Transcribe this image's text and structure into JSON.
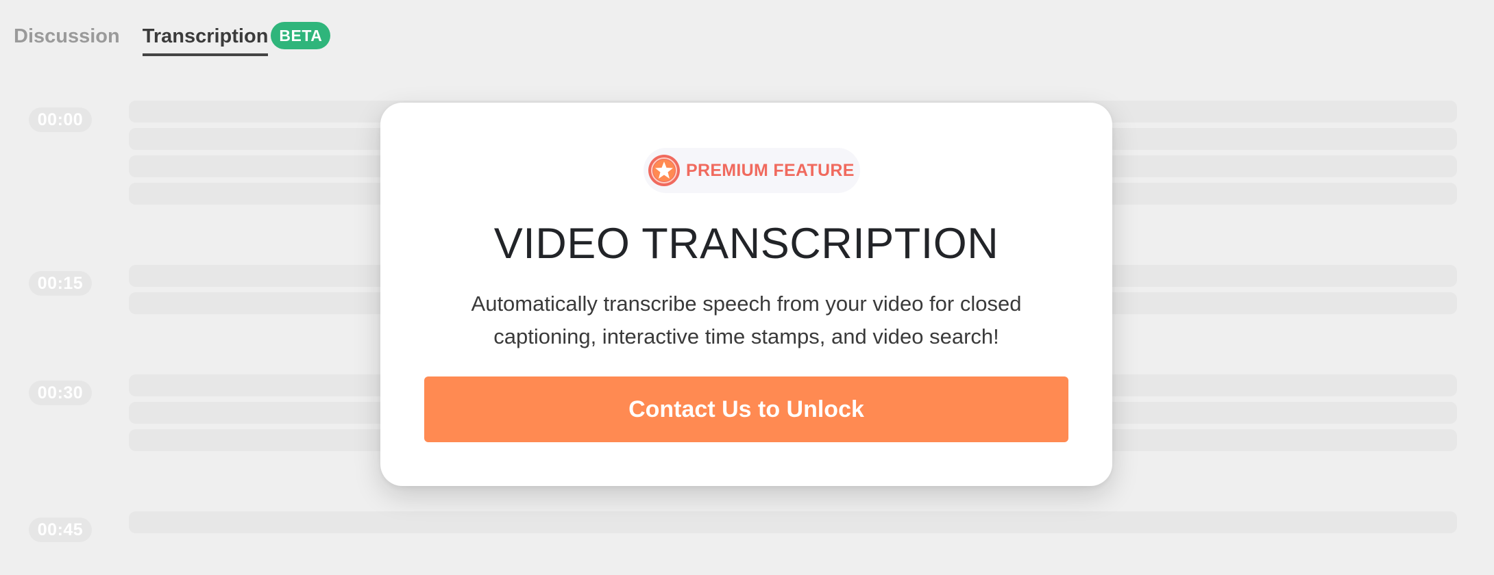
{
  "tabs": {
    "discussion_label": "Discussion",
    "transcription_label": "Transcription",
    "beta_badge": "BETA"
  },
  "transcript": {
    "timestamps": [
      "00:00",
      "00:15",
      "00:30",
      "00:45"
    ]
  },
  "modal": {
    "badge_icon": "star-icon",
    "badge_label": "PREMIUM FEATURE",
    "title": "VIDEO TRANSCRIPTION",
    "description": "Automatically transcribe speech from your video for closed captioning, interactive time stamps, and video search!",
    "cta_label": "Contact Us to Unlock"
  },
  "colors": {
    "background": "#efefef",
    "beta_badge": "#2fb57b",
    "premium_accent": "#f06a5e",
    "cta": "#ff8a52",
    "active_tab_text": "#3b3b3b",
    "inactive_tab_text": "#9a9a9a"
  }
}
